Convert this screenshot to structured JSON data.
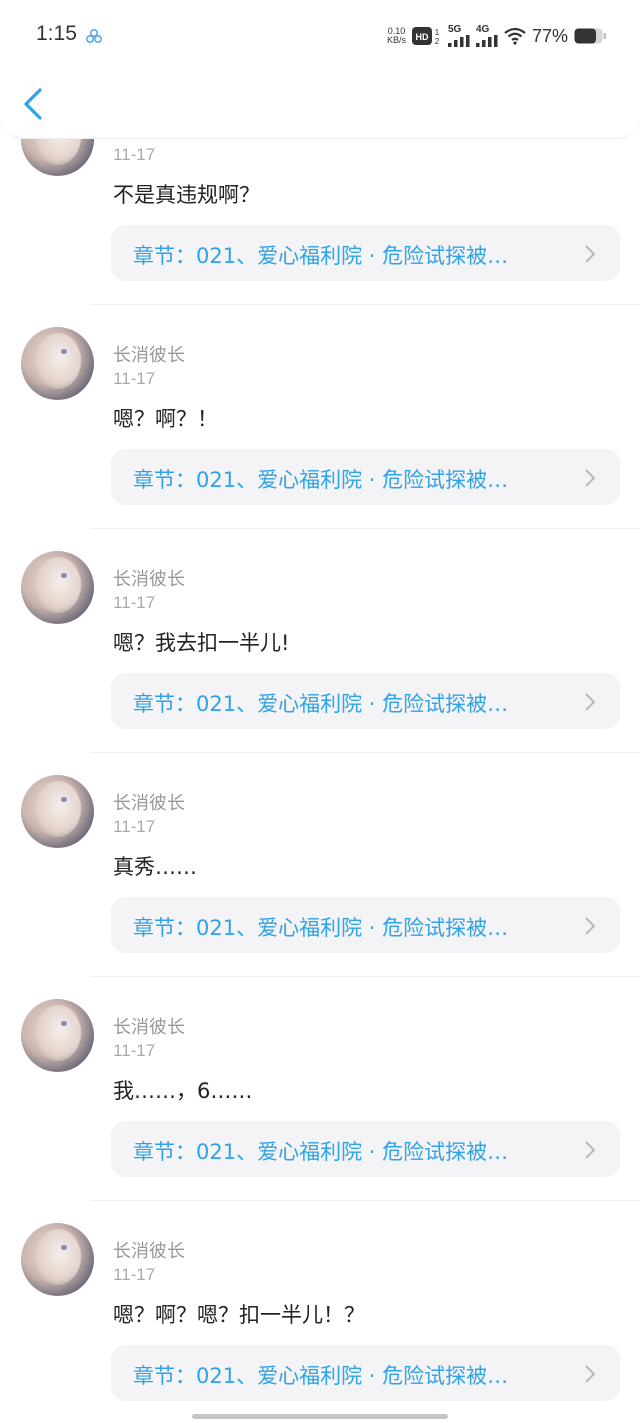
{
  "status_bar": {
    "time": "1:15",
    "net_speed_value": "0.10",
    "net_speed_unit": "KB/s",
    "signal_1_label": "5G",
    "signal_2_label": "4G",
    "battery_percent": "77%",
    "icons": [
      "app-dot-icon",
      "hd-icon",
      "signal-bars-icon",
      "wifi-icon",
      "battery-icon"
    ]
  },
  "nav": {
    "back_icon": "back-chevron-icon"
  },
  "accent_color": "#2ea3e8",
  "comments": [
    {
      "username": "",
      "date": "11-17",
      "text": "不是真违规啊？",
      "chapter": "章节：021、爱心福利院 · 危险试探被…"
    },
    {
      "username": "长消彼长",
      "date": "11-17",
      "text": "嗯？啊？！",
      "chapter": "章节：021、爱心福利院 · 危险试探被…"
    },
    {
      "username": "长消彼长",
      "date": "11-17",
      "text": "嗯？我去扣一半儿!",
      "chapter": "章节：021、爱心福利院 · 危险试探被…"
    },
    {
      "username": "长消彼长",
      "date": "11-17",
      "text": "真秀……",
      "chapter": "章节：021、爱心福利院 · 危险试探被…"
    },
    {
      "username": "长消彼长",
      "date": "11-17",
      "text": "我……，6……",
      "chapter": "章节：021、爱心福利院 · 危险试探被…"
    },
    {
      "username": "长消彼长",
      "date": "11-17",
      "text": "嗯？啊？嗯？扣一半儿！？",
      "chapter": "章节：021、爱心福利院 · 危险试探被…"
    }
  ]
}
